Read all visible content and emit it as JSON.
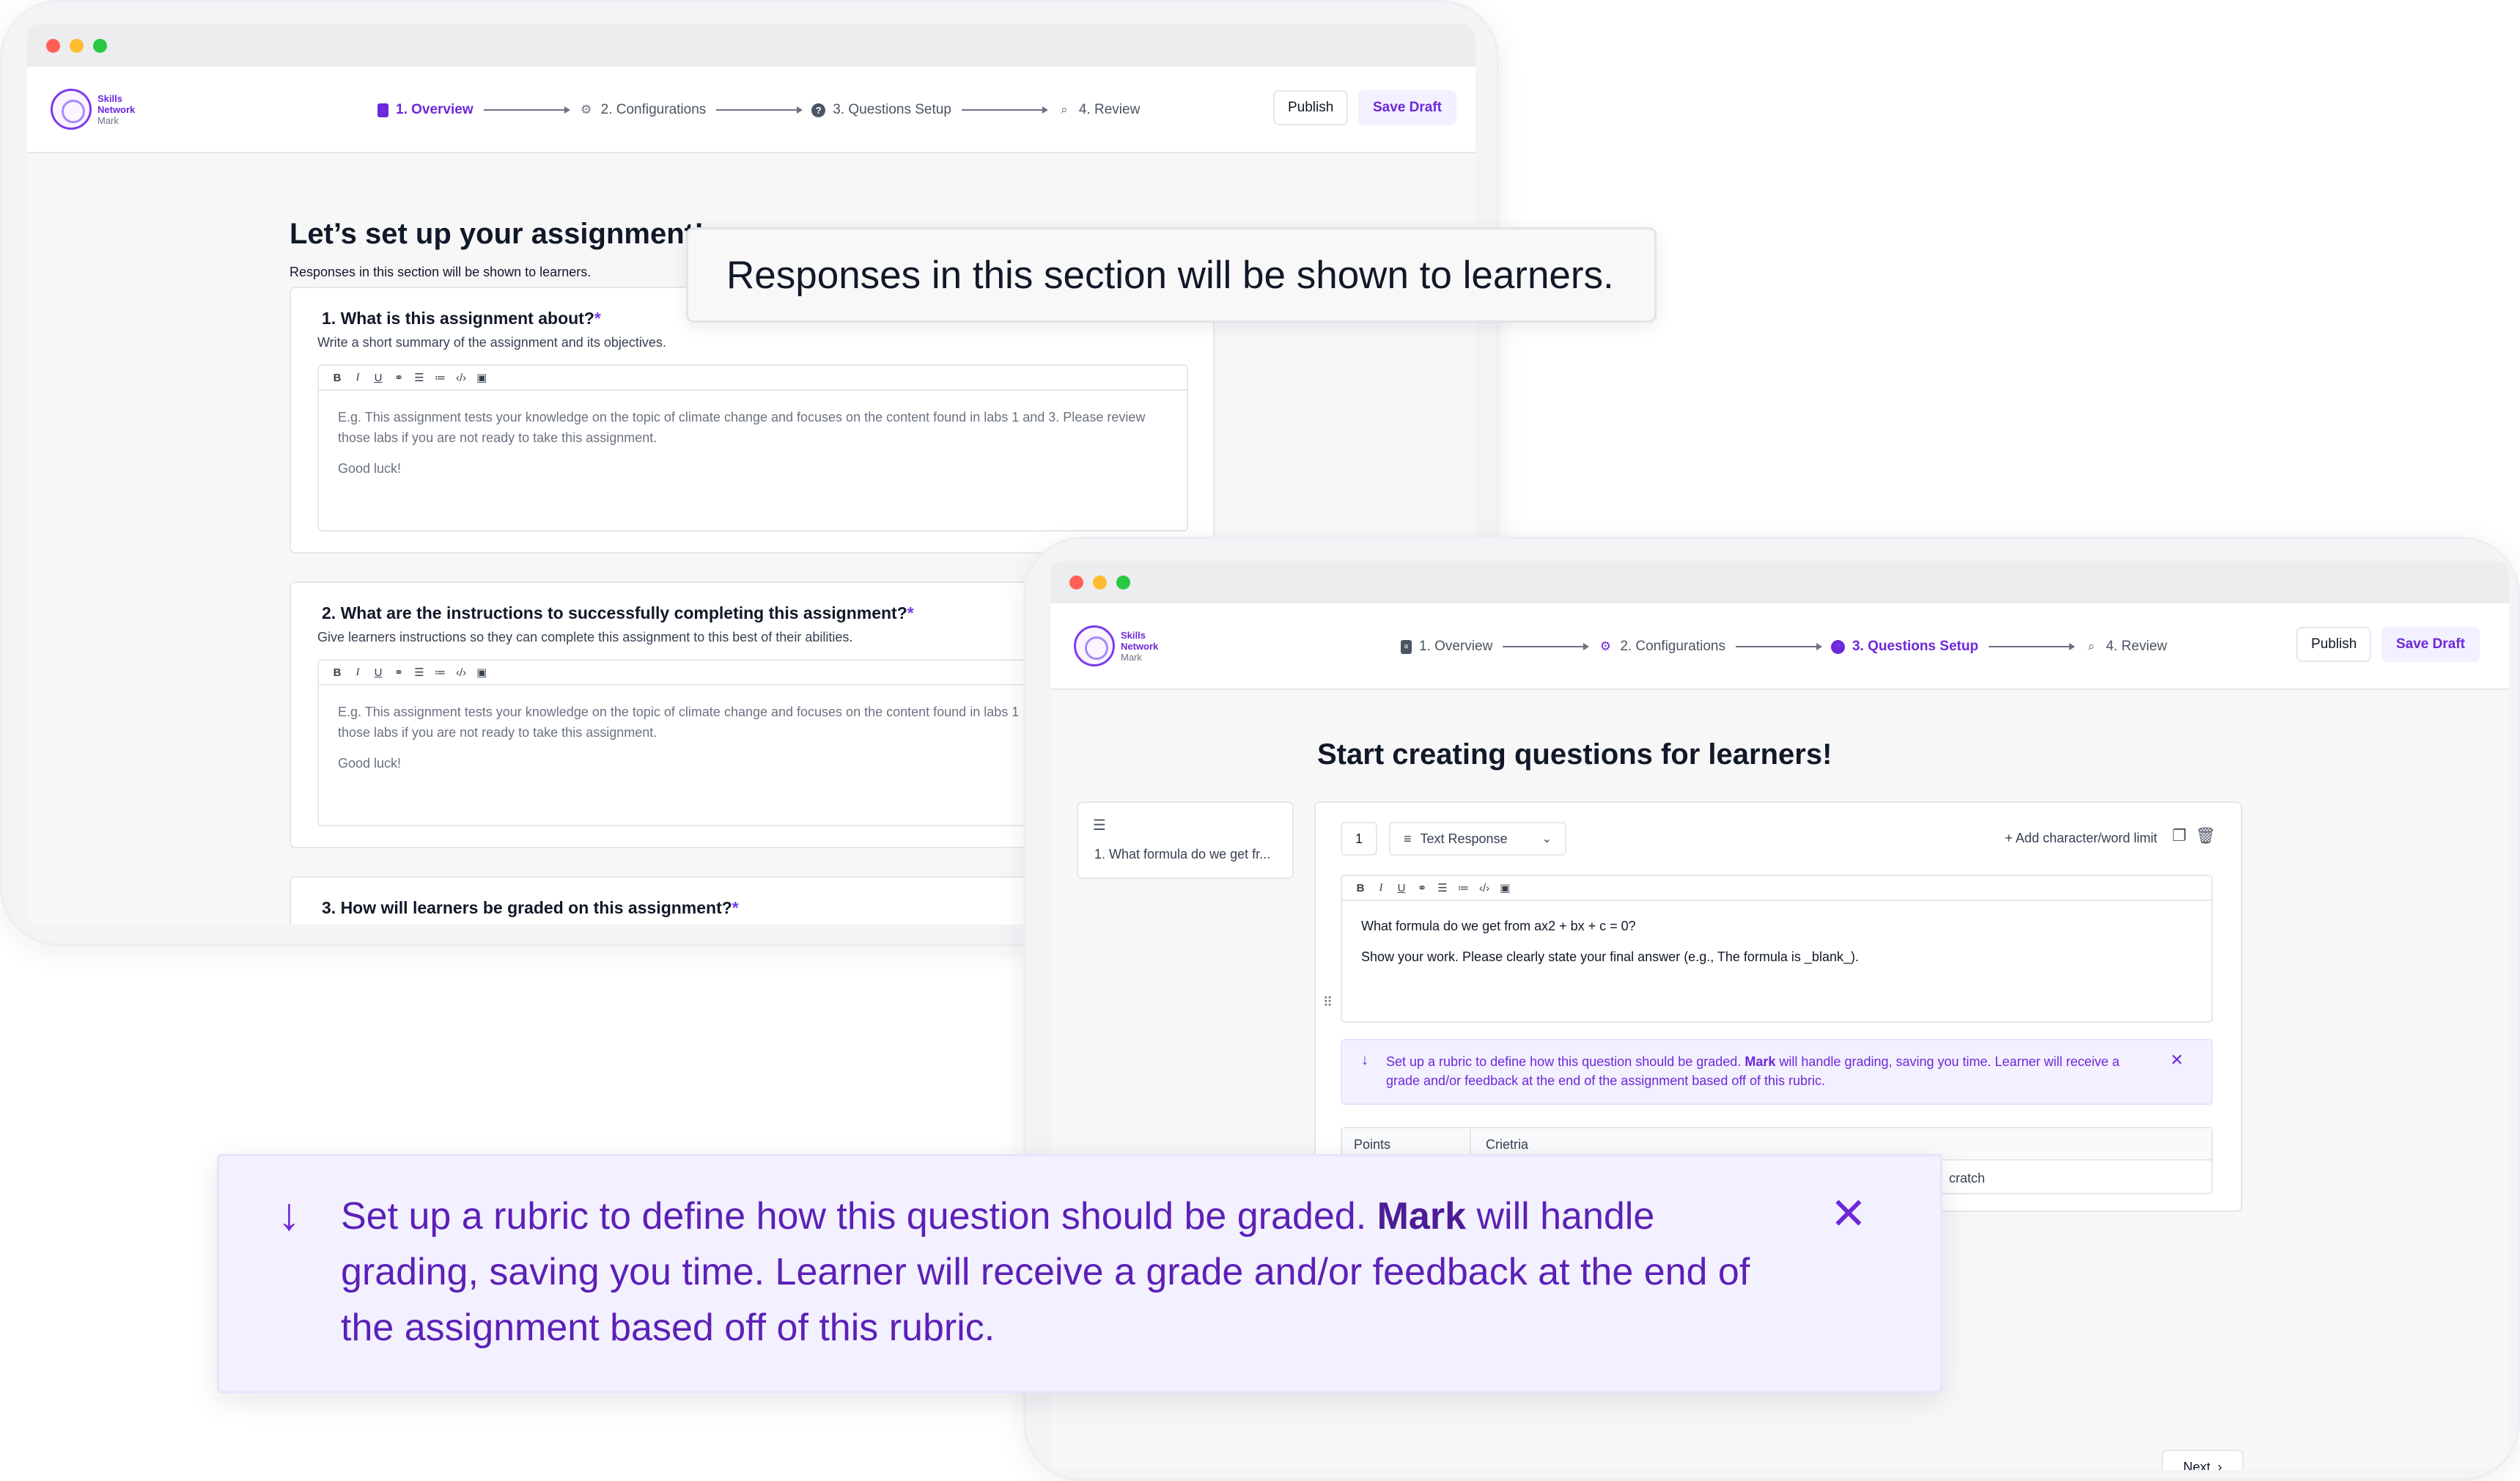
{
  "shared": {
    "logo": {
      "line1": "Skills",
      "line2": "Network",
      "line3": "Mark"
    },
    "steps": [
      "1. Overview",
      "2. Configurations",
      "3. Questions Setup",
      "4. Review"
    ],
    "publish_label": "Publish",
    "save_draft_label": "Save Draft",
    "editor_toolbar": [
      "B",
      "I",
      "U",
      "link",
      "bullet-list",
      "numbered-list",
      "code",
      "image"
    ]
  },
  "window1": {
    "active_step": "1. Overview",
    "title": "Let’s set up your assignment!",
    "subtitle": "Responses in this section will be shown to learners.",
    "questions": [
      {
        "label": "1. What is this assignment about?",
        "required": "*",
        "hint": "Write a short summary of the assignment and its objectives.",
        "placeholder_line1": "E.g. This assignment tests your knowledge on the topic of climate change and focuses on the content found in labs 1 and 3. Please review those labs if you are not ready to take this assignment.",
        "placeholder_line2": "Good luck!"
      },
      {
        "label": "2. What are the instructions to successfully completing this assignment?",
        "required": "*",
        "hint": "Give learners instructions so they can complete this assignment to this best of their abilities.",
        "placeholder_line1": "E.g. This assignment tests your knowledge on the topic of climate change and focuses on the content found in labs 1 and 3. Please review those labs if you are not ready to take this assignment.",
        "placeholder_line2": "Good luck!"
      },
      {
        "label": "3. How will learners be graded on this assignment?",
        "required": "*"
      }
    ]
  },
  "window2": {
    "active_step": "3. Questions Setup",
    "title": "Start creating questions for learners!",
    "sidebar_item": "1. What formula do we get fr...",
    "question_number": "1",
    "question_type": "Text Response",
    "add_limit_label": "+ Add character/word limit",
    "question_text_line1": "What formula do we get from ax2 + bx + c = 0?",
    "question_text_line2": "Show your work. Please clearly state your final answer (e.g., The formula is _blank_).",
    "rubric_tip_pre": "Set up a rubric to define how this question should be graded.",
    "rubric_tip_bold": "Mark",
    "rubric_tip_post": "will handle grading, saving you time. Learner will receive a grade and/or feedback at the end of the assignment based off of this rubric.",
    "table_headers": [
      "Points",
      "Crietria"
    ],
    "table_cell": "cratch",
    "next_label": "Next"
  },
  "callouts": {
    "top_text": "Responses in this section will be shown to learners.",
    "bottom_pre": "Set up a rubric to define how this question should be graded.",
    "bottom_bold": "Mark",
    "bottom_post": "will handle grading, saving you time. Learner will receive a grade and/or feedback at the end of the assignment based off of this rubric."
  },
  "colors": {
    "accent": "#6d28d9",
    "accent_light": "#f3f0ff",
    "border": "#e5e7eb"
  }
}
